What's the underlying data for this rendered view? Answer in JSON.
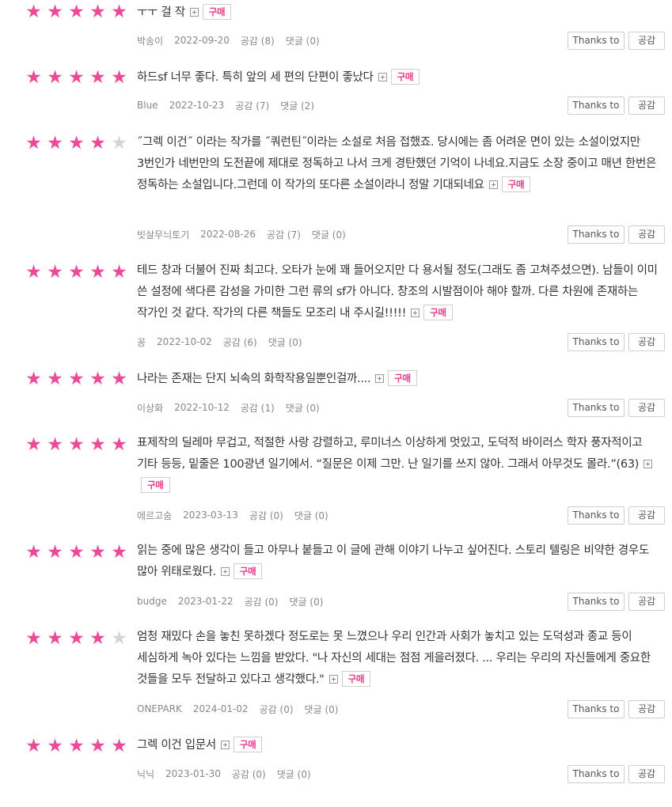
{
  "labels": {
    "thanks": "Thanks to",
    "like": "공감",
    "purchase": "구매"
  },
  "reviews": [
    {
      "rating": 5,
      "text": "ㅜㅜ 걸 작",
      "author": "박송이",
      "date": "2022-09-20",
      "likes": "공감 (8)",
      "comments": "댓글 (0)"
    },
    {
      "rating": 5,
      "text": "하드sf 너무 좋다. 특히 앞의 세 편의 단편이 좋났다",
      "author": "Blue",
      "date": "2022-10-23",
      "likes": "공감 (7)",
      "comments": "댓글 (2)"
    },
    {
      "rating": 4,
      "text": "˝그렉 이건˝ 이라는 작가를 ˝쿼런틴˝이라는 소설로 처음 접했죠. 당시에는 좀 어려운 면이 있는 소설이었지만 3번인가 네번만의 도전끝에 제대로 정독하고 나서 크게 경탄했던 기억이 나네요.지금도 소장 중이고 매년 한번은 정독하는 소설입니다.그런데 이 작가의 또다른 소설이라니 정말 기대되네요",
      "author": "빗살무늬토기",
      "date": "2022-08-26",
      "likes": "공감 (7)",
      "comments": "댓글 (0)"
    },
    {
      "rating": 5,
      "text": "테드 창과 더불어 진짜 최고다. 오타가 눈에 꽤 들어오지만 다 용서될 정도(그래도 좀 고쳐주셨으면). 남들이 이미 쓴 설정에 색다른 감성을 가미한 그런 류의 sf가 아니다. 창조의 시발점이아 해야 할까. 다른 차원에 존재하는 작가인 것 같다. 작가의 다른 책들도 모조리 내 주시길!!!!!",
      "author": "꽁",
      "date": "2022-10-02",
      "likes": "공감 (6)",
      "comments": "댓글 (0)"
    },
    {
      "rating": 5,
      "text": "나라는 존재는 단지 뇌속의 화학작용일뿐인걸까....",
      "author": "이상화",
      "date": "2022-10-12",
      "likes": "공감 (1)",
      "comments": "댓글 (0)"
    },
    {
      "rating": 5,
      "text": "표제작의 딜레마 무겁고, 적절한 사랑 강렬하고, 루미너스 이상하게 멋있고, 도덕적 바이러스 학자 풍자적이고 기타 등등, 밑줄은 100광년 일기에서. “질문은 이제 그만. 난 일기를 쓰지 않아. 그래서 아무것도 몰라.”(63)",
      "author": "에르고숨",
      "date": "2023-03-13",
      "likes": "공감 (0)",
      "comments": "댓글 (0)"
    },
    {
      "rating": 5,
      "text": "읽는 중에 많은 생각이 들고 아무나 붙들고 이 글에 관해 이야기 나누고 싶어진다. 스토리 텔링은 비약한 경우도 많아 위태로웠다.",
      "author": "budge",
      "date": "2023-01-22",
      "likes": "공감 (0)",
      "comments": "댓글 (0)"
    },
    {
      "rating": 4,
      "text": "엄청 재밌다 손을 놓친 못하겠다 정도로는 못 느꼈으나 우리 인간과 사회가 놓치고 있는 도덕성과 종교 등이 세심하게 녹아 있다는 느낌을 받았다. \"나 자신의 세대는 점점 게을러졌다. ... 우리는 우리의 자신들에게 중요한 것들을 모두 전달하고 있다고 생각했다.\"",
      "author": "ONEPARK",
      "date": "2024-01-02",
      "likes": "공감 (0)",
      "comments": "댓글 (0)"
    },
    {
      "rating": 5,
      "text": "그렉 이건 입문서",
      "author": "닉닉",
      "date": "2023-01-30",
      "likes": "공감 (0)",
      "comments": "댓글 (0)"
    }
  ]
}
